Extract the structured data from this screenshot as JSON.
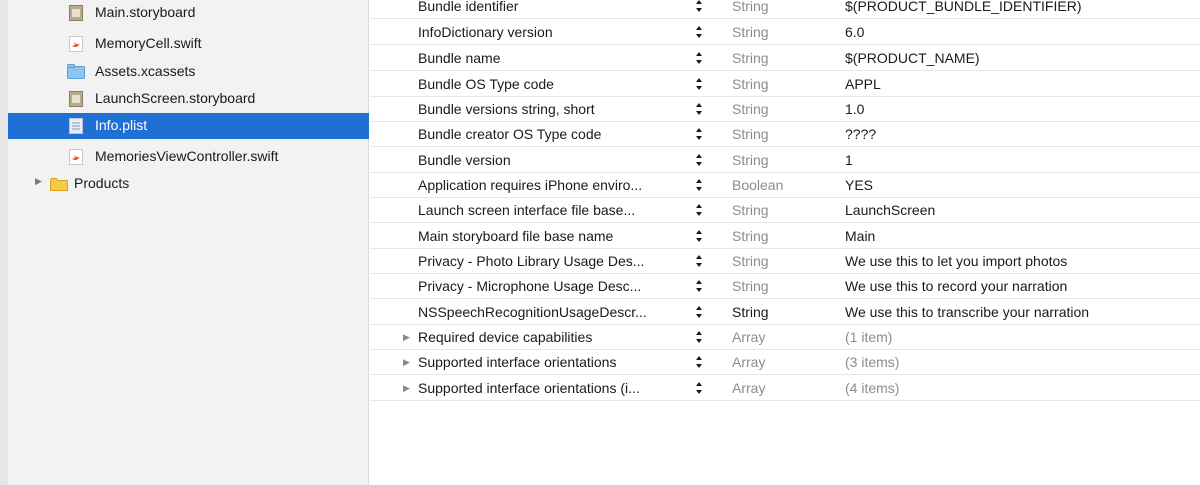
{
  "navigator": {
    "files": [
      {
        "name": "Main.storyboard",
        "icon": "storyboard-file-icon",
        "selected": false
      },
      {
        "name": "MemoryCell.swift",
        "icon": "swift-file-icon",
        "selected": false
      },
      {
        "name": "Assets.xcassets",
        "icon": "asset-catalog-icon",
        "selected": false
      },
      {
        "name": "LaunchScreen.storyboard",
        "icon": "storyboard-file-icon",
        "selected": false
      },
      {
        "name": "Info.plist",
        "icon": "plist-file-icon",
        "selected": true
      },
      {
        "name": "MemoriesViewController.swift",
        "icon": "swift-file-icon",
        "selected": false
      }
    ],
    "products_group": {
      "name": "Products",
      "icon": "folder-icon",
      "expanded": false
    },
    "selection_color": "#1f6fd4"
  },
  "plist": {
    "rows": [
      {
        "key": "Bundle identifier",
        "type": "String",
        "value": "$(PRODUCT_BUNDLE_IDENTIFIER)"
      },
      {
        "key": "InfoDictionary version",
        "type": "String",
        "value": "6.0"
      },
      {
        "key": "Bundle name",
        "type": "String",
        "value": "$(PRODUCT_NAME)"
      },
      {
        "key": "Bundle OS Type code",
        "type": "String",
        "value": "APPL"
      },
      {
        "key": "Bundle versions string, short",
        "type": "String",
        "value": "1.0"
      },
      {
        "key": "Bundle creator OS Type code",
        "type": "String",
        "value": "????"
      },
      {
        "key": "Bundle version",
        "type": "String",
        "value": "1"
      },
      {
        "key": "Application requires iPhone enviro...",
        "type": "Boolean",
        "value": "YES"
      },
      {
        "key": "Launch screen interface file base...",
        "type": "String",
        "value": "LaunchScreen"
      },
      {
        "key": "Main storyboard file base name",
        "type": "String",
        "value": "Main"
      },
      {
        "key": "Privacy - Photo Library Usage Des...",
        "type": "String",
        "value": "We use this to let you import photos"
      },
      {
        "key": "Privacy - Microphone Usage Desc...",
        "type": "String",
        "value": "We use this to record your narration"
      },
      {
        "key": "NSSpeechRecognitionUsageDescr...",
        "type": "String",
        "value": "We use this to transcribe your narration",
        "type_emphasis": true
      },
      {
        "key": "Required device capabilities",
        "type": "Array",
        "value": "(1 item)",
        "expandable": true
      },
      {
        "key": "Supported interface orientations",
        "type": "Array",
        "value": "(3 items)",
        "expandable": true
      },
      {
        "key": "Supported interface orientations (i...",
        "type": "Array",
        "value": "(4 items)",
        "expandable": true
      }
    ]
  },
  "glyphs": {
    "disclosure_collapsed": "▶"
  }
}
